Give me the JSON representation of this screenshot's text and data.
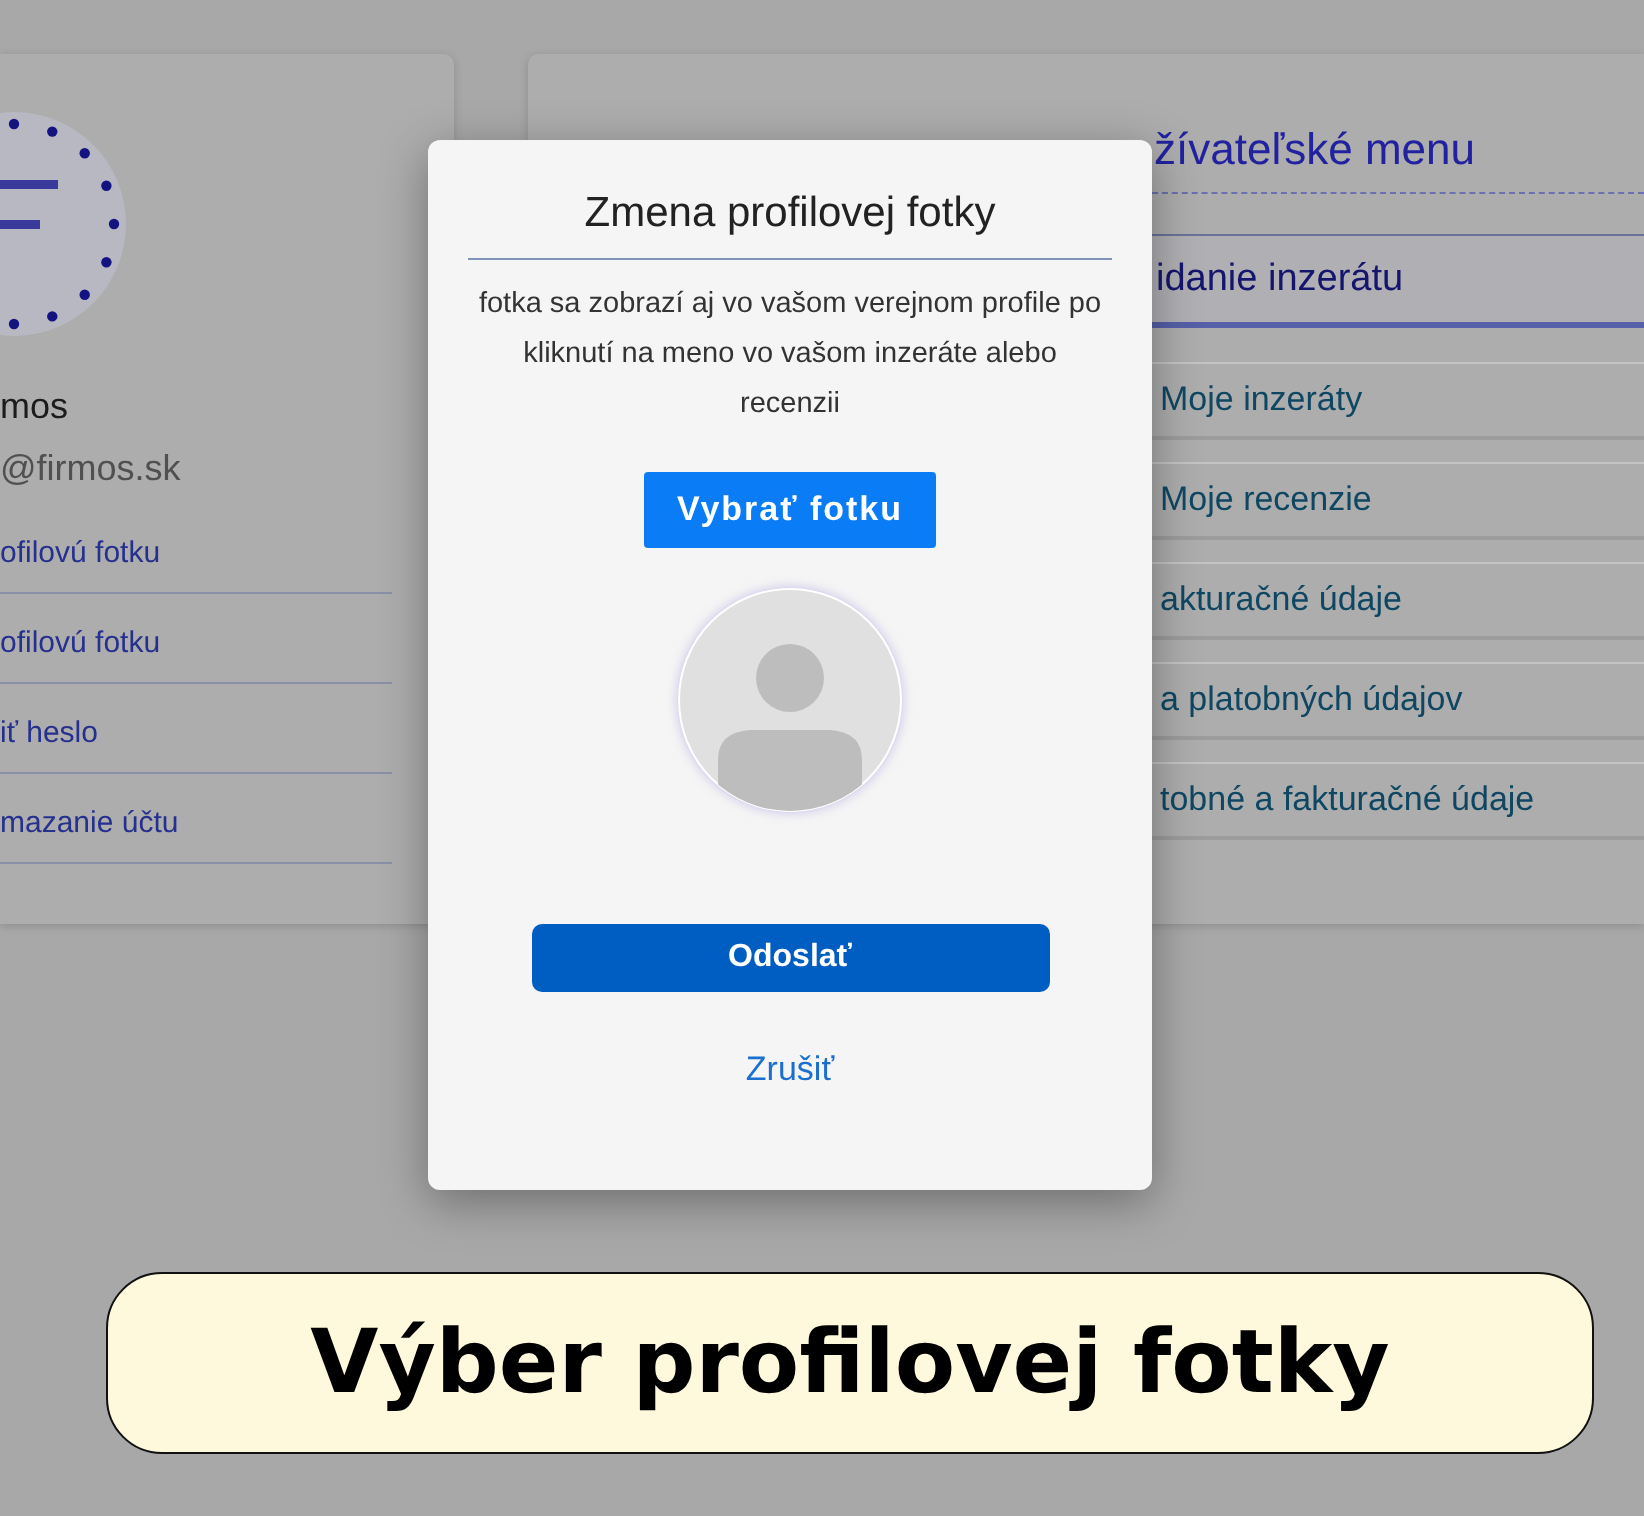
{
  "profile_card": {
    "name": "mos",
    "email": "@firmos.sk",
    "links": [
      "ofilovú fotku",
      "ofilovú fotku",
      "iť heslo",
      "mazanie účtu"
    ]
  },
  "user_menu": {
    "title": "žívateľské menu",
    "items": [
      {
        "label": "idanie inzerátu",
        "kind": "primary"
      },
      {
        "label": "Moje inzeráty",
        "kind": "link"
      },
      {
        "label": "Moje recenzie",
        "kind": "link"
      },
      {
        "label": "akturačné údaje",
        "kind": "link"
      },
      {
        "label": "a platobných údajov",
        "kind": "link"
      },
      {
        "label": "tobné a fakturačné údaje",
        "kind": "link"
      }
    ]
  },
  "dialog": {
    "title": "Zmena profilovej fotky",
    "description": "fotka sa zobrazí aj vo vašom verejnom profile po kliknutí na meno vo vašom inzeráte alebo recenzii",
    "choose_button": "Vybrať fotku",
    "submit_button": "Odoslať",
    "cancel_link": "Zrušiť"
  },
  "caption": "Výber profilovej fotky"
}
